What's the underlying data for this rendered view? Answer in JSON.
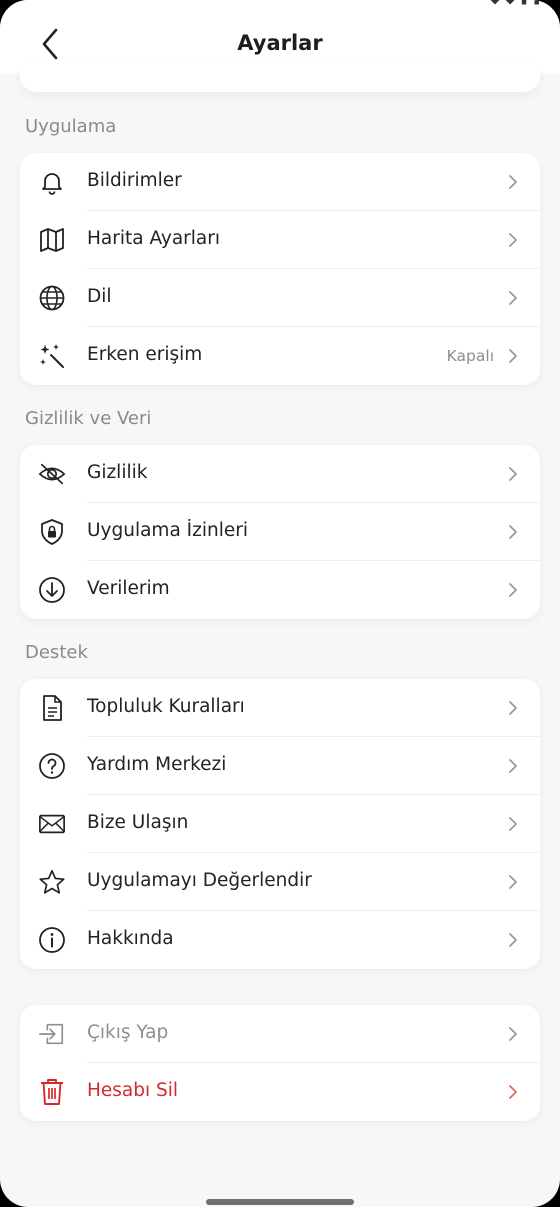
{
  "colors": {
    "accent_danger": "#d62a2a",
    "muted_text": "#8f8f8f",
    "background": "#f7f7f7",
    "card": "#ffffff"
  },
  "header": {
    "title": "Ayarlar",
    "back_icon": "chevron-left-icon"
  },
  "sections": [
    {
      "title": "Uygulama",
      "items": [
        {
          "label": "Bildirimler",
          "icon": "bell-icon"
        },
        {
          "label": "Harita Ayarları",
          "icon": "map-icon"
        },
        {
          "label": "Dil",
          "icon": "globe-icon"
        },
        {
          "label": "Erken erişim",
          "icon": "sparkle-wand-icon",
          "value": "Kapalı"
        }
      ]
    },
    {
      "title": "Gizlilik ve Veri",
      "items": [
        {
          "label": "Gizlilik",
          "icon": "eye-off-icon"
        },
        {
          "label": "Uygulama İzinleri",
          "icon": "shield-lock-icon"
        },
        {
          "label": "Verilerim",
          "icon": "download-circle-icon"
        }
      ]
    },
    {
      "title": "Destek",
      "items": [
        {
          "label": "Topluluk Kuralları",
          "icon": "document-icon"
        },
        {
          "label": "Yardım Merkezi",
          "icon": "help-circle-icon"
        },
        {
          "label": "Bize Ulaşın",
          "icon": "mail-icon"
        },
        {
          "label": "Uygulamayı Değerlendir",
          "icon": "star-icon"
        },
        {
          "label": "Hakkında",
          "icon": "info-icon"
        }
      ]
    }
  ],
  "account": {
    "items": [
      {
        "label": "Çıkış Yap",
        "icon": "logout-icon"
      },
      {
        "label": "Hesabı Sil",
        "icon": "trash-icon"
      }
    ]
  }
}
